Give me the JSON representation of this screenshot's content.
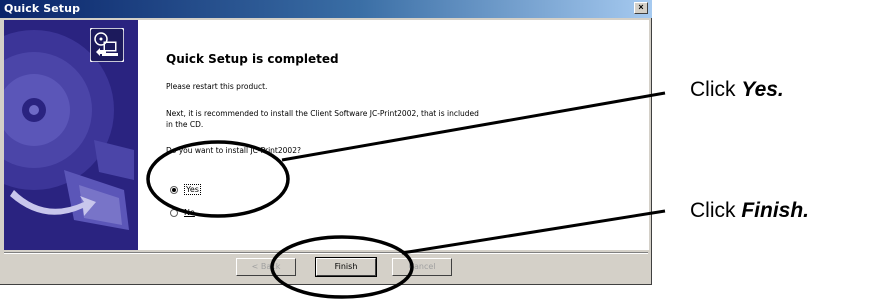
{
  "window": {
    "title": "Quick Setup",
    "close_glyph": "×"
  },
  "main": {
    "heading": "Quick Setup is completed",
    "message_restart": "Please restart this product.",
    "message_recommend": "Next, it is recommended to install the Client Software JC-Print2002, that is included in the CD.",
    "question": "Do you want to install JC-Print2002?"
  },
  "options": {
    "yes_label": "Yes",
    "no_label": "No",
    "selected": "Yes"
  },
  "buttons": {
    "back_label": "< Back",
    "finish_label": "Finish",
    "cancel_label": "Cancel"
  },
  "annotations": {
    "click_prefix_1": "Click ",
    "click_target_1": "Yes.",
    "click_prefix_2": "Click ",
    "click_target_2": "Finish."
  },
  "colors": {
    "titlebar": "#0a246a",
    "dialog_bg": "#d4d0c8",
    "banner": "#2a2380"
  },
  "icons": [
    "setup-computer-icon",
    "cd-disc-graphic",
    "close-icon",
    "radio-selected-icon",
    "radio-unselected-icon"
  ]
}
